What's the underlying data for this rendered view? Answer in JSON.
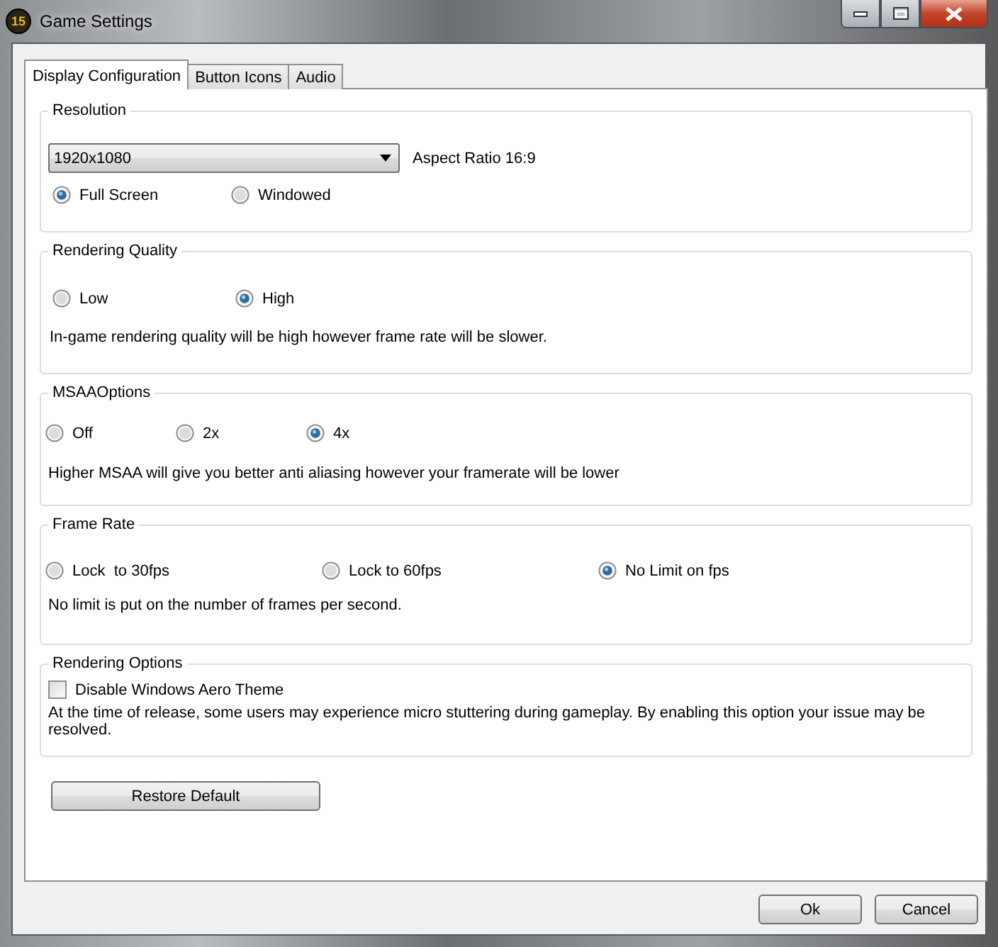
{
  "window": {
    "title": "Game Settings",
    "icon_label": "15"
  },
  "tabs": [
    {
      "label": "Display Configuration",
      "selected": true
    },
    {
      "label": "Button Icons",
      "selected": false
    },
    {
      "label": "Audio",
      "selected": false
    }
  ],
  "groups": [
    {
      "kind": "resolution",
      "title": "Resolution",
      "dropdown": {
        "value": "1920x1080"
      },
      "aspect_ratio": "Aspect Ratio 16:9",
      "options": [
        {
          "label": "Full Screen",
          "selected": true
        },
        {
          "label": "Windowed",
          "selected": false
        }
      ]
    },
    {
      "kind": "radio",
      "title": "Rendering Quality",
      "options": [
        {
          "label": "Low",
          "selected": false
        },
        {
          "label": "High",
          "selected": true
        }
      ],
      "description": "In-game rendering quality will be high however frame rate will be slower."
    },
    {
      "kind": "radio",
      "title": "MSAAOptions",
      "options": [
        {
          "label": "Off",
          "selected": false
        },
        {
          "label": "2x",
          "selected": false
        },
        {
          "label": "4x",
          "selected": true
        }
      ],
      "description": "Higher MSAA will give you better anti aliasing however your framerate will be lower"
    },
    {
      "kind": "radio",
      "title": "Frame Rate",
      "options": [
        {
          "label": "Lock  to 30fps",
          "selected": false
        },
        {
          "label": "Lock to 60fps",
          "selected": false
        },
        {
          "label": "No Limit on fps",
          "selected": true
        }
      ],
      "description": "No limit is put on the number of frames per second."
    },
    {
      "kind": "checkbox",
      "title": "Rendering Options",
      "checkbox": {
        "label": "Disable Windows Aero Theme",
        "checked": false
      },
      "description": "At the time of release, some users may experience micro stuttering during gameplay. By enabling this option your issue may be resolved."
    }
  ],
  "restore_button": "Restore Default",
  "buttons": [
    "Ok",
    "Cancel"
  ]
}
